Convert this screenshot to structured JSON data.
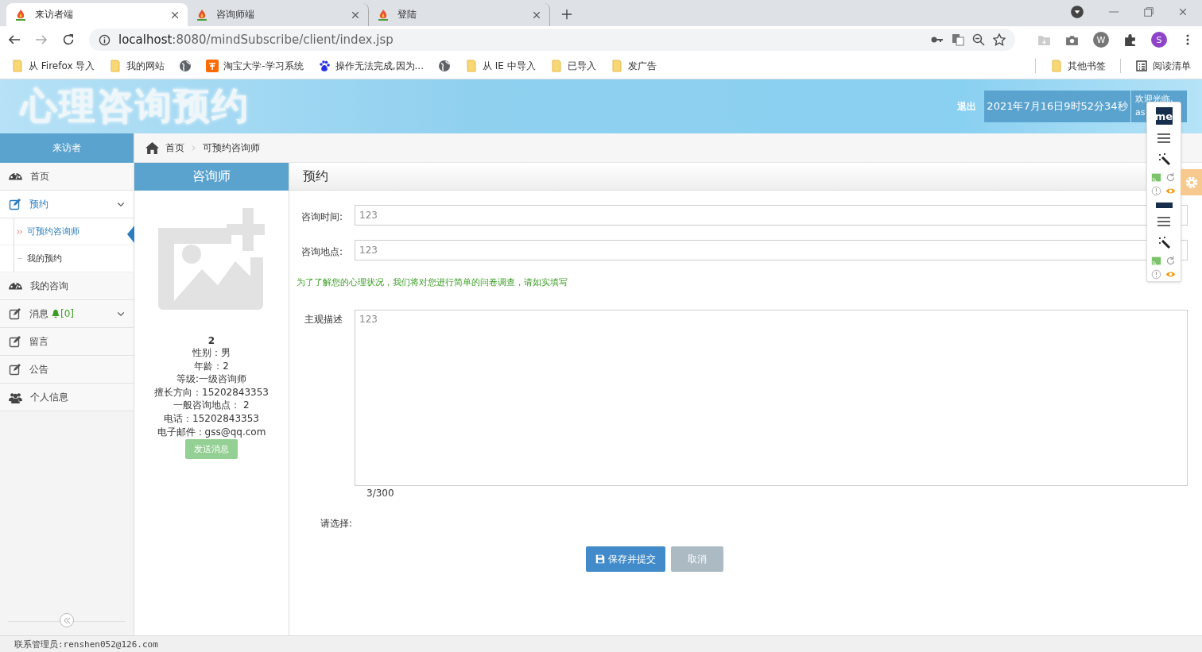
{
  "browser": {
    "tabs": [
      {
        "title": "来访者端",
        "selected": true
      },
      {
        "title": "咨询师端",
        "selected": false
      },
      {
        "title": "登陆",
        "selected": false
      }
    ],
    "url_host": "localhost",
    "url_rest": ":8080/mindSubscribe/client/index.jsp",
    "extension_letter": "W",
    "profile_initial": "S",
    "bookmarks": [
      {
        "label": "从 Firefox 导入",
        "kind": "folder"
      },
      {
        "label": "我的网站",
        "kind": "folder"
      },
      {
        "kind": "globe"
      },
      {
        "label": "淘宝大学-学习系统",
        "kind": "taobao"
      },
      {
        "label": "操作无法完成,因为...",
        "kind": "paw"
      },
      {
        "kind": "globe"
      },
      {
        "label": "从 IE 中导入",
        "kind": "folder"
      },
      {
        "label": "已导入",
        "kind": "folder"
      },
      {
        "label": "发广告",
        "kind": "folder"
      }
    ],
    "right_bookmarks": [
      {
        "label": "其他书签",
        "kind": "folder"
      },
      {
        "label": "阅读清单",
        "kind": "list"
      }
    ]
  },
  "header": {
    "title": "心理咨询预约",
    "logout": "退出",
    "datetime": "2021年7月16日9时52分34秒",
    "welcome": "欢迎光临,",
    "user": "as"
  },
  "floating_toolbar": {
    "logo": "me"
  },
  "sidebar": {
    "role": "来访者",
    "items": [
      {
        "label": "首页",
        "kind": "dashboard",
        "selected": false
      },
      {
        "label": "预约",
        "kind": "edit",
        "selected": true,
        "expandable": true,
        "children": [
          {
            "label": "可预约咨询师",
            "selected": true
          },
          {
            "label": "我的预约",
            "selected": false
          }
        ]
      },
      {
        "label": "我的咨询",
        "kind": "dashboard",
        "selected": false
      },
      {
        "label": "消息",
        "kind": "edit",
        "selected": false,
        "expandable": true,
        "badge": "[0]"
      },
      {
        "label": "留言",
        "kind": "edit",
        "selected": false
      },
      {
        "label": "公告",
        "kind": "edit",
        "selected": false
      },
      {
        "label": "个人信息",
        "kind": "users",
        "selected": false
      }
    ]
  },
  "breadcrumb": [
    "首页",
    "可预约咨询师"
  ],
  "counselor": {
    "heading": "咨询师",
    "name": "2",
    "details": [
      "性别：男",
      "年龄：2",
      "等级:一级咨询师",
      "擅长方向：15202843353",
      "一般咨询地点： 2",
      "电话：15202843353",
      "电子邮件：gss@qq.com"
    ],
    "button": {
      "label": "发送消息",
      "disabled": true
    }
  },
  "form": {
    "heading": "预约",
    "fields": [
      {
        "label": "咨询时间:",
        "value": "123"
      },
      {
        "label": "咨询地点:",
        "value": "123"
      }
    ],
    "notice": "为了了解您的心理状况，我们将对您进行简单的问卷调查，请如实填写",
    "description": {
      "label": "主观描述",
      "value": "123",
      "counter": "3/300"
    },
    "select_label": "请选择:",
    "buttons": [
      {
        "label": "保存并提交",
        "kind": "primary"
      },
      {
        "label": "取消",
        "kind": "default"
      }
    ]
  },
  "status_bar": "联系管理员:renshen052@126.com"
}
